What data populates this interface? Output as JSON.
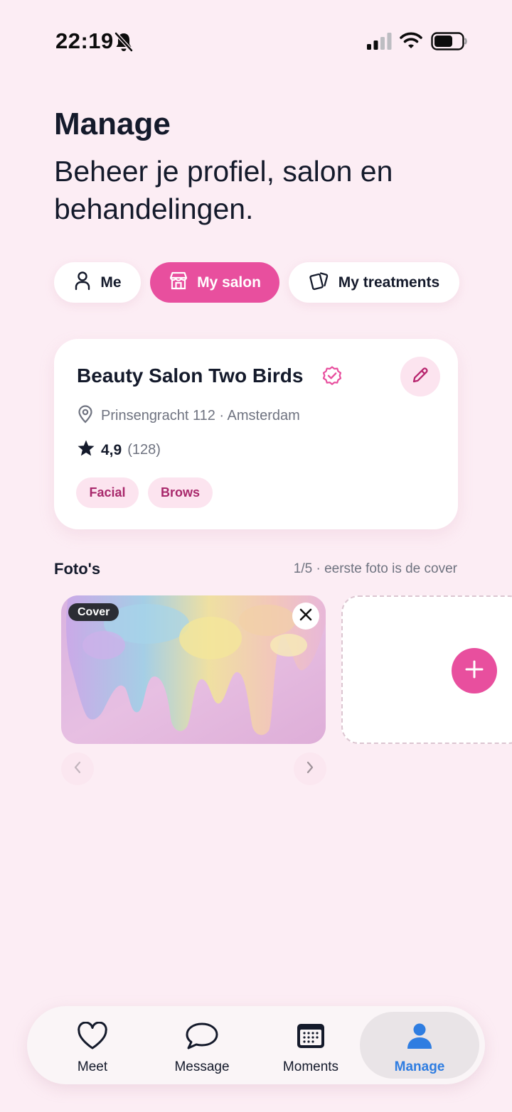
{
  "status": {
    "time": "22:19"
  },
  "header": {
    "title": "Manage",
    "subtitle": "Beheer je profiel, salon en behandelingen."
  },
  "tabs": [
    {
      "label": "Me",
      "icon": "person-icon",
      "active": false
    },
    {
      "label": "My salon",
      "icon": "store-icon",
      "active": true
    },
    {
      "label": "My treatments",
      "icon": "cards-icon",
      "active": false
    }
  ],
  "salon": {
    "name": "Beauty Salon Two Birds",
    "address": "Prinsengracht 112 · Amsterdam",
    "rating": "4,9",
    "reviews": "(128)",
    "tags": [
      "Facial",
      "Brows"
    ]
  },
  "photos": {
    "title": "Foto's",
    "meta": "1/5 · eerste foto is de cover",
    "cover_label": "Cover"
  },
  "bottom_nav": [
    {
      "label": "Meet",
      "icon": "heart-icon",
      "active": false
    },
    {
      "label": "Message",
      "icon": "chat-bubble-icon",
      "active": false
    },
    {
      "label": "Moments",
      "icon": "calendar-icon",
      "active": false
    },
    {
      "label": "Manage",
      "icon": "profile-icon",
      "active": true
    }
  ],
  "colors": {
    "background": "#fcedf4",
    "accent_pink": "#e84f9e",
    "active_blue": "#2f7de1",
    "text_dark": "#141a2b"
  }
}
